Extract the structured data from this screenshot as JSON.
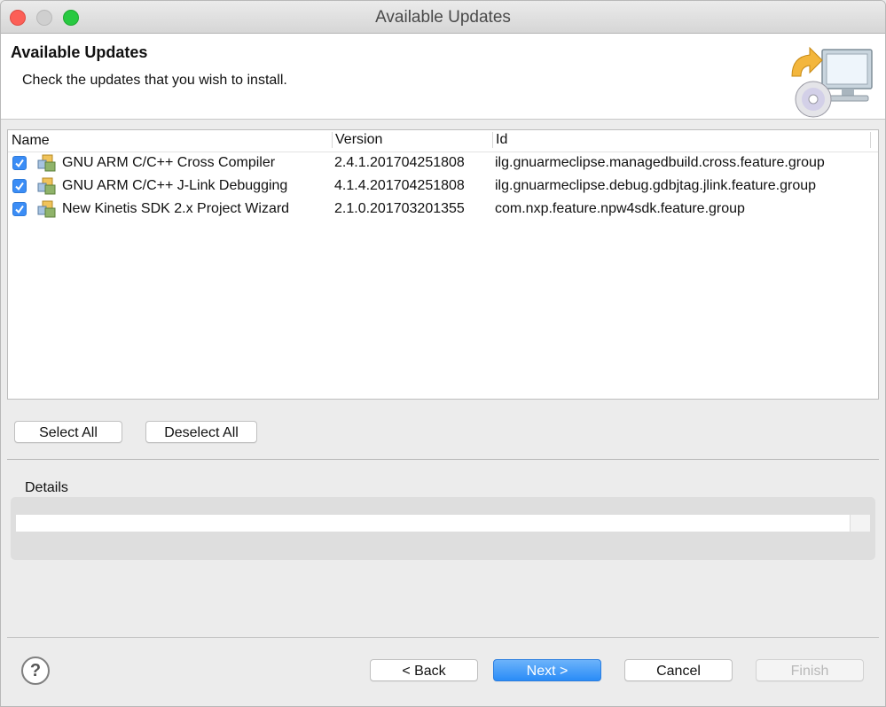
{
  "window": {
    "title": "Available Updates"
  },
  "header": {
    "title": "Available Updates",
    "subtitle": "Check the updates that you wish to install."
  },
  "table": {
    "columns": [
      "Name",
      "Version",
      "Id"
    ],
    "rows": [
      {
        "name": "GNU ARM C/C++ Cross Compiler",
        "version": "2.4.1.201704251808",
        "id": "ilg.gnuarmeclipse.managedbuild.cross.feature.group",
        "checked": true
      },
      {
        "name": "GNU ARM C/C++ J-Link Debugging",
        "version": "4.1.4.201704251808",
        "id": "ilg.gnuarmeclipse.debug.gdbjtag.jlink.feature.group",
        "checked": true
      },
      {
        "name": "New Kinetis SDK 2.x Project Wizard",
        "version": "2.1.0.201703201355",
        "id": "com.nxp.feature.npw4sdk.feature.group",
        "checked": true
      }
    ]
  },
  "selection": {
    "select_all": "Select All",
    "deselect_all": "Deselect All"
  },
  "details": {
    "label": "Details",
    "value": ""
  },
  "footer": {
    "help": "?",
    "back": "< Back",
    "next": "Next >",
    "cancel": "Cancel",
    "finish": "Finish"
  },
  "colors": {
    "accent": "#3b8df6",
    "close": "#fc5f57",
    "maximize": "#28c941"
  },
  "icons": [
    "checkbox-checked-icon",
    "feature-plugin-icon",
    "install-update-icon",
    "help-icon"
  ]
}
